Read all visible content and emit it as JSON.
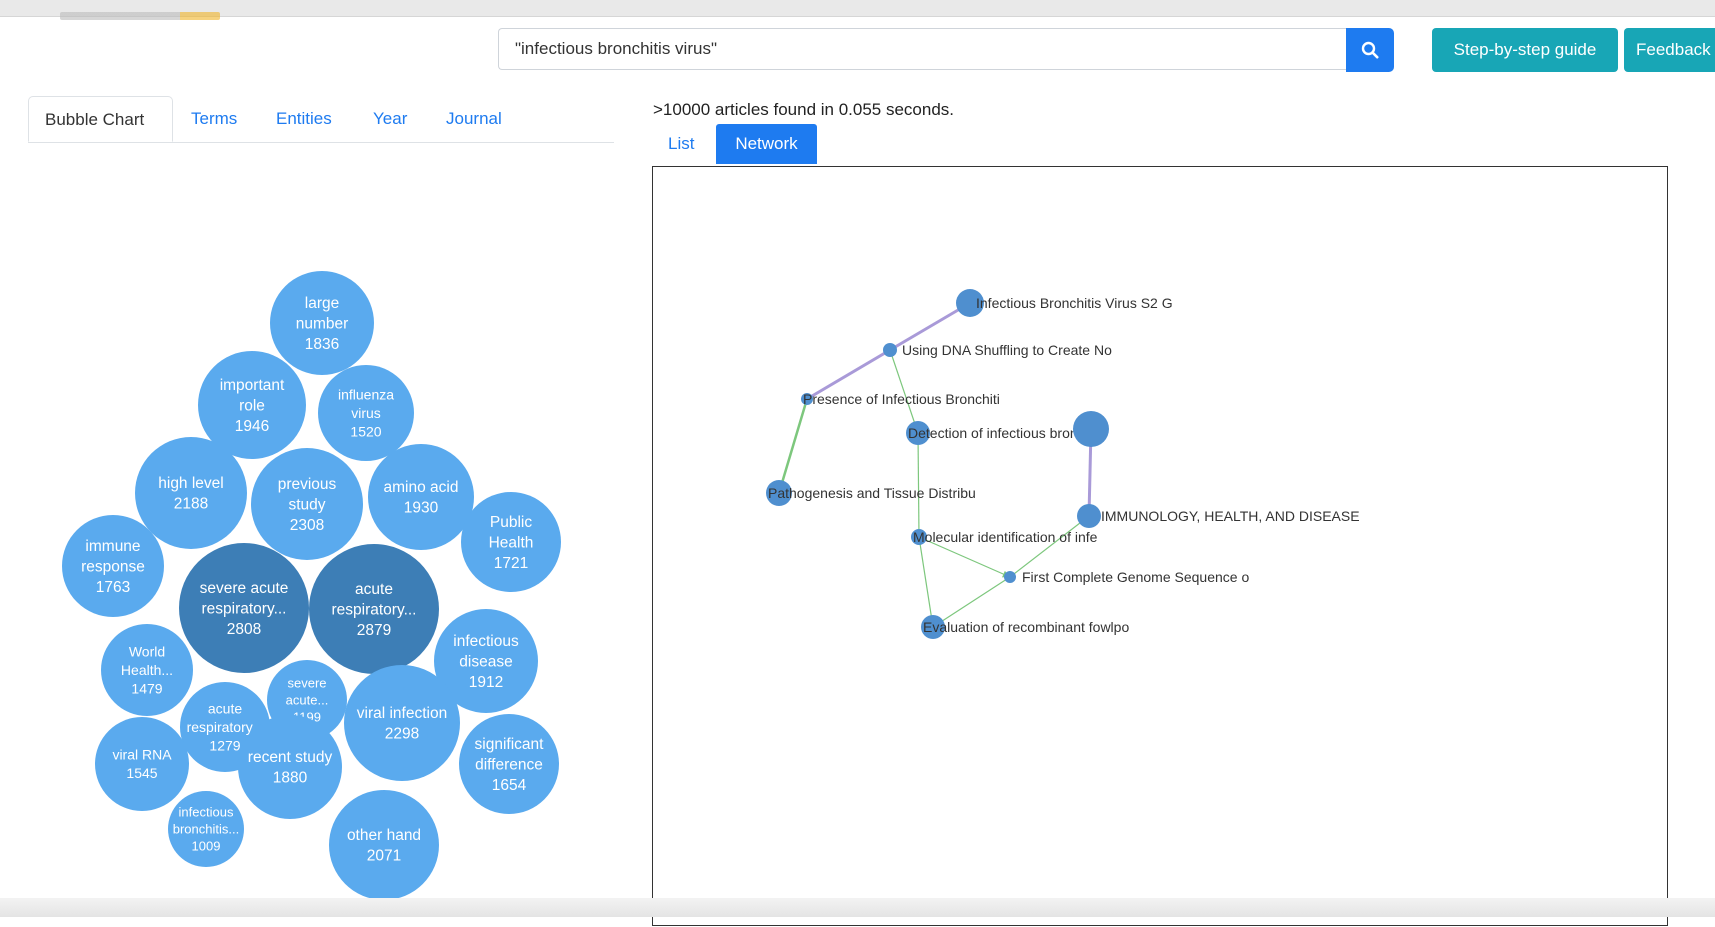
{
  "search": {
    "value": "\"infectious bronchitis virus\"",
    "button_icon": "search-icon"
  },
  "header": {
    "guide_label": "Step-by-step guide",
    "feedback_label": "Feedback"
  },
  "left_tabs": [
    "Bubble Chart",
    "Terms",
    "Entities",
    "Year",
    "Journal"
  ],
  "results": {
    "summary": ">10000 articles found in 0.055 seconds.",
    "tabs": [
      "List",
      "Network"
    ],
    "active_tab": "Network"
  },
  "colors": {
    "bubble_light": "#5aaaee",
    "bubble_dark": "#3d7eb6",
    "accent": "#1e7bf0",
    "teal": "#18a6b6",
    "node": "#4f8fcf",
    "edge_green": "#7dc77d",
    "edge_purple": "#a99ad8"
  },
  "bubbles": [
    {
      "lines": [
        "large",
        "number"
      ],
      "count": "1836"
    },
    {
      "lines": [
        "important",
        "role"
      ],
      "count": "1946"
    },
    {
      "lines": [
        "influenza",
        "virus"
      ],
      "count": "1520"
    },
    {
      "lines": [
        "high level"
      ],
      "count": "2188"
    },
    {
      "lines": [
        "previous",
        "study"
      ],
      "count": "2308"
    },
    {
      "lines": [
        "amino acid"
      ],
      "count": "1930"
    },
    {
      "lines": [
        "Public",
        "Health"
      ],
      "count": "1721"
    },
    {
      "lines": [
        "immune",
        "response"
      ],
      "count": "1763"
    },
    {
      "lines": [
        "severe acute",
        "respiratory..."
      ],
      "count": "2808",
      "dark": true
    },
    {
      "lines": [
        "acute",
        "respiratory..."
      ],
      "count": "2879",
      "dark": true
    },
    {
      "lines": [
        "infectious",
        "disease"
      ],
      "count": "1912"
    },
    {
      "lines": [
        "World",
        "Health..."
      ],
      "count": "1479"
    },
    {
      "lines": [
        "severe",
        "acute..."
      ],
      "count": "1199"
    },
    {
      "lines": [
        "acute",
        "respiratory..."
      ],
      "count": "1279"
    },
    {
      "lines": [
        "viral infection"
      ],
      "count": "2298"
    },
    {
      "lines": [
        "significant",
        "difference"
      ],
      "count": "1654"
    },
    {
      "lines": [
        "viral RNA"
      ],
      "count": "1545"
    },
    {
      "lines": [
        "recent study"
      ],
      "count": "1880"
    },
    {
      "lines": [
        "infectious",
        "bronchitis..."
      ],
      "count": "1009"
    },
    {
      "lines": [
        "other hand"
      ],
      "count": "2071"
    }
  ],
  "network": {
    "nodes": [
      {
        "id": "n1",
        "label": "Infectious Bronchitis Virus S2 G"
      },
      {
        "id": "n2",
        "label": "Using DNA Shuffling to Create No"
      },
      {
        "id": "n3",
        "label": "Presence of Infectious Bronchiti"
      },
      {
        "id": "n4",
        "label": "Detection of infectious bronchit"
      },
      {
        "id": "n5",
        "label": "Pathogenesis and Tissue Distribu"
      },
      {
        "id": "n6",
        "label": "IMMUNOLOGY, HEALTH, AND DISEASE"
      },
      {
        "id": "n7",
        "label": "Molecular identification of infe"
      },
      {
        "id": "n8",
        "label": "First Complete Genome Sequence o"
      },
      {
        "id": "n9",
        "label": "Evaluation of recombinant fowlpo"
      },
      {
        "id": "n10",
        "label": ""
      }
    ],
    "edges": [
      {
        "from": "n1",
        "to": "n2",
        "color": "purple"
      },
      {
        "from": "n2",
        "to": "n3",
        "color": "purple"
      },
      {
        "from": "n5",
        "to": "n3",
        "color": "green"
      },
      {
        "from": "n2",
        "to": "n4",
        "color": "green"
      },
      {
        "from": "n4",
        "to": "n7",
        "color": "green"
      },
      {
        "from": "n10",
        "to": "n6",
        "color": "purple"
      },
      {
        "from": "n7",
        "to": "n8",
        "color": "green"
      },
      {
        "from": "n7",
        "to": "n9",
        "color": "green"
      },
      {
        "from": "n9",
        "to": "n8",
        "color": "green"
      },
      {
        "from": "n8",
        "to": "n6",
        "color": "green"
      }
    ]
  }
}
